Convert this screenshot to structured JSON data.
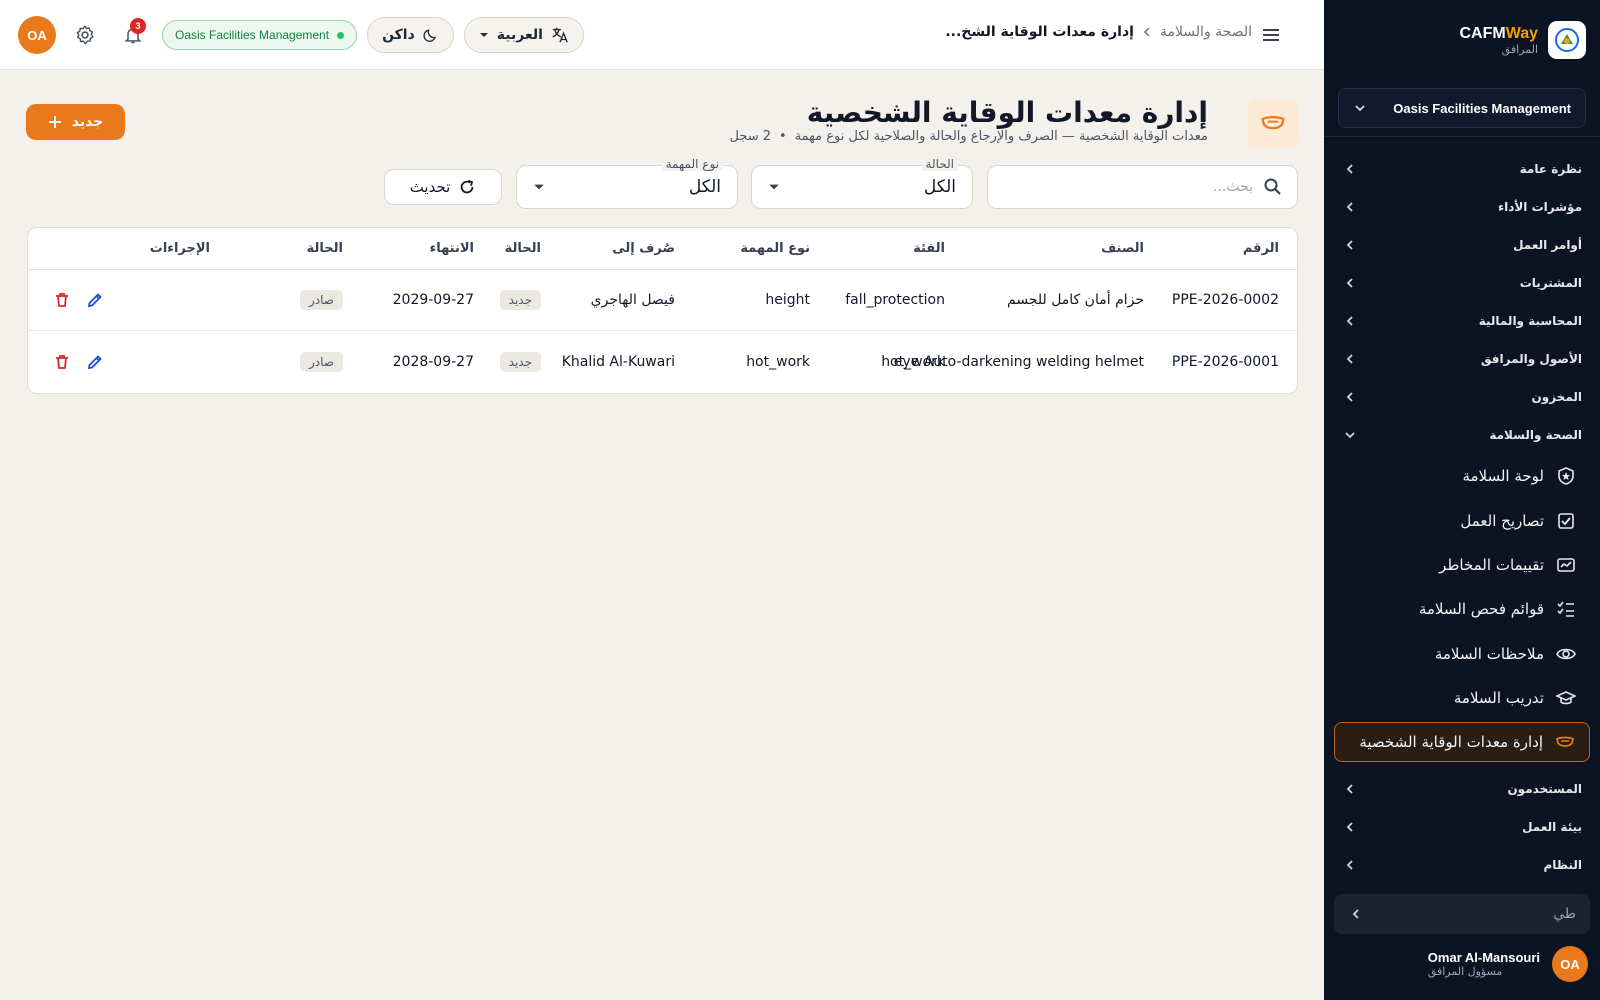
{
  "topbar": {
    "avatar_initials": "OA",
    "notif_count": "3",
    "org_chip": "Oasis Facilities Management",
    "theme_label": "داكن",
    "lang_label": "العربية",
    "breadcrumb_parent": "الصحة والسلامة",
    "breadcrumb_current": "إدارة معدات الوقاية الشخ..."
  },
  "sidebar": {
    "brand_name_a": "CAFM",
    "brand_name_b": "Way",
    "brand_sub": "المرافق",
    "org_select": "Oasis Facilities Management",
    "groups_top": [
      {
        "label": "نظرة عامة"
      },
      {
        "label": "مؤشرات الأداء"
      },
      {
        "label": "أوامر العمل"
      },
      {
        "label": "المشتريات"
      },
      {
        "label": "المحاسبة والمالية"
      },
      {
        "label": "الأصول والمرافق"
      },
      {
        "label": "المخزون"
      },
      {
        "label": "الصحة والسلامة"
      }
    ],
    "subitems": [
      {
        "label": "لوحة السلامة",
        "icon": "shield-icon"
      },
      {
        "label": "تصاريح العمل",
        "icon": "checkbox-icon"
      },
      {
        "label": "تقييمات المخاطر",
        "icon": "risk-icon"
      },
      {
        "label": "قوائم فحص السلامة",
        "icon": "checklist-icon"
      },
      {
        "label": "ملاحظات السلامة",
        "icon": "eye-icon"
      },
      {
        "label": "تدريب السلامة",
        "icon": "graduation-icon"
      },
      {
        "label": "إدارة معدات الوقاية الشخصية",
        "icon": "mask-icon"
      }
    ],
    "groups_bottom": [
      {
        "label": "المستخدمون"
      },
      {
        "label": "بيئة العمل"
      },
      {
        "label": "النظام"
      }
    ],
    "search_text": "طي",
    "user_initials": "OA",
    "user_name": "Omar Al-Mansouri",
    "user_role": "مسؤول المرافق"
  },
  "main": {
    "title": "إدارة معدات الوقاية الشخصية",
    "subtitle": "معدات الوقاية الشخصية — الصرف والإرجاع والحالة والصلاحية لكل نوع مهمة",
    "record_count": "2 سجل",
    "new_button": "جديد",
    "search_placeholder": "بحث...",
    "filter_status_label": "الحالة",
    "filter_status_value": "الكل",
    "filter_task_label": "نوع المهمة",
    "filter_task_value": "الكل",
    "refresh_label": "تحديث"
  },
  "table": {
    "headers": {
      "number": "الرقم",
      "item": "الصنف",
      "category": "الفئة",
      "task_type": "نوع المهمة",
      "issued_to": "صُرف إلى",
      "condition": "الحالة",
      "expiry": "الانتهاء",
      "status": "الحالة",
      "actions": "الإجراءات"
    },
    "rows": [
      {
        "number": "PPE-2026-0002",
        "item": "حزام أمان كامل للجسم",
        "category": "fall_protection",
        "task_type": "height",
        "issued_to": "فيصل الهاجري",
        "condition": "جديد",
        "expiry": "2029-09-27",
        "status": "صادر"
      },
      {
        "number": "PPE-2026-0001",
        "item": "eye Auto-darkening welding helmet",
        "category": "hot_work",
        "task_type": "hot_work",
        "issued_to": "Khalid Al-Kuwari",
        "condition": "جديد",
        "expiry": "2028-09-27",
        "status": "صادر"
      }
    ]
  },
  "colors": {
    "accent": "#e87a1c",
    "sidebar_bg": "#0c1424",
    "page_bg": "#f4f1ec",
    "success": "#22c55e",
    "danger": "#dc2626",
    "edit": "#1d4ed8"
  }
}
